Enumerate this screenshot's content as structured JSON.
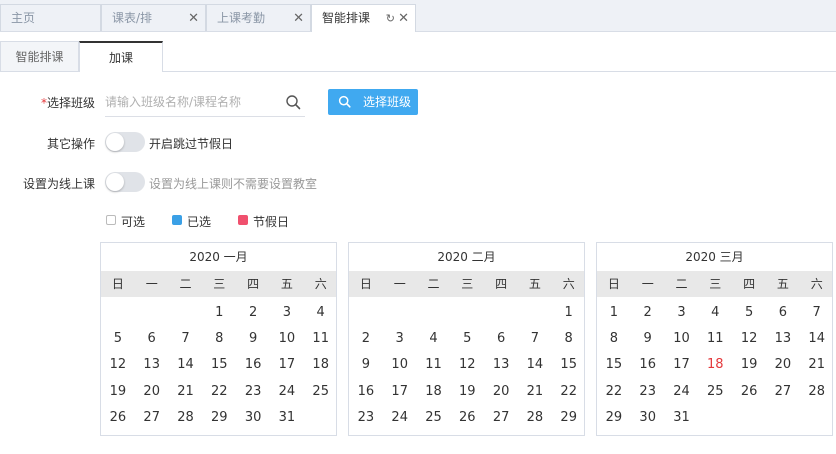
{
  "top_tabs": [
    {
      "label": "主页",
      "closable": false,
      "active": false
    },
    {
      "label": "课表/排",
      "closable": true,
      "active": false
    },
    {
      "label": "上课考勤",
      "closable": true,
      "active": false
    },
    {
      "label": "智能排课",
      "closable": true,
      "active": true
    }
  ],
  "sub_tabs": [
    {
      "label": "智能排课",
      "active": false
    },
    {
      "label": "加课",
      "active": true
    }
  ],
  "form": {
    "select_class_label": "选择班级",
    "required_mark": "*",
    "search_placeholder": "请输入班级名称/课程名称",
    "select_class_button": "选择班级",
    "other_ops_label": "其它操作",
    "skip_holiday_text": "开启跳过节假日",
    "skip_holiday_on": false,
    "online_label": "设置为线上课",
    "online_text": "设置为线上课则不需要设置教室",
    "online_on": false
  },
  "legend": {
    "available": "可选",
    "selected": "已选",
    "holiday": "节假日",
    "colors": {
      "available": "#ffffff",
      "selected": "#3aa0e6",
      "holiday": "#f0506e"
    }
  },
  "weekdays": [
    "日",
    "一",
    "二",
    "三",
    "四",
    "五",
    "六"
  ],
  "calendars": [
    {
      "title": "2020 一月",
      "first_weekday": 3,
      "days": 31,
      "holidays": []
    },
    {
      "title": "2020 二月",
      "first_weekday": 6,
      "days": 29,
      "holidays": []
    },
    {
      "title": "2020 三月",
      "first_weekday": 0,
      "days": 31,
      "holidays": [
        18
      ]
    }
  ],
  "colors": {
    "accent": "#40a9f0",
    "holiday_text": "#e4393c"
  }
}
